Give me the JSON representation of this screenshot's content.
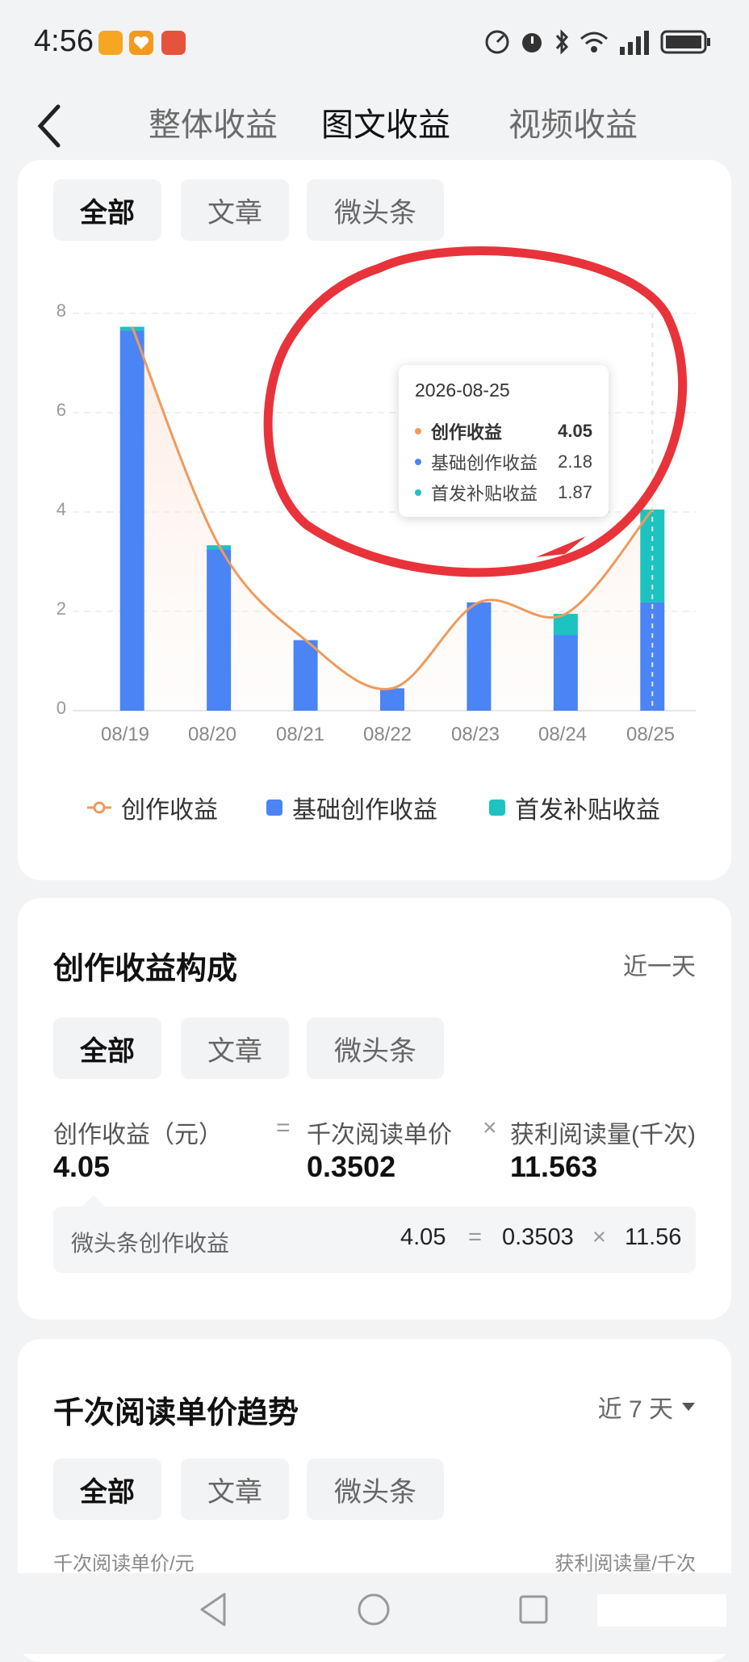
{
  "status_bar": {
    "time": "4:56"
  },
  "nav": {
    "tabs": [
      "整体收益",
      "图文收益",
      "视频收益"
    ],
    "active": 1
  },
  "chart_card": {
    "filters": [
      "全部",
      "文章",
      "微头条"
    ],
    "selected_filter": "全部",
    "y_ticks": [
      "0",
      "2",
      "4",
      "6",
      "8"
    ],
    "tooltip": {
      "date": "2026-08-25",
      "rows": [
        {
          "label": "创作收益",
          "value": "4.05",
          "color": "#ef9a5c",
          "bold": true
        },
        {
          "label": "基础创作收益",
          "value": "2.18",
          "color": "#4a84f5",
          "bold": false
        },
        {
          "label": "首发补贴收益",
          "value": "1.87",
          "color": "#1cc3c0",
          "bold": false
        }
      ]
    },
    "legend": [
      {
        "label": "创作收益",
        "color": "#ef9a5c",
        "shape": "line-dot"
      },
      {
        "label": "基础创作收益",
        "color": "#4a84f5",
        "shape": "square"
      },
      {
        "label": "首发补贴收益",
        "color": "#1cc3c0",
        "shape": "square"
      }
    ]
  },
  "chart_data": {
    "type": "bar",
    "stacked": true,
    "categories": [
      "08/19",
      "08/20",
      "08/21",
      "08/22",
      "08/23",
      "08/24",
      "08/25"
    ],
    "ylim": [
      0,
      8
    ],
    "grid": true,
    "series": [
      {
        "name": "基础创作收益",
        "type": "bar",
        "color": "#4a84f5",
        "values": [
          7.65,
          3.25,
          1.42,
          0.45,
          2.18,
          1.52,
          2.18
        ]
      },
      {
        "name": "首发补贴收益",
        "type": "bar",
        "color": "#1cc3c0",
        "values": [
          0.08,
          0.08,
          0.0,
          0.0,
          0.0,
          0.43,
          1.87
        ]
      },
      {
        "name": "创作收益",
        "type": "line",
        "smooth": true,
        "color": "#ef9a5c",
        "values": [
          7.73,
          3.33,
          1.42,
          0.45,
          2.18,
          1.95,
          4.05
        ]
      }
    ]
  },
  "composition": {
    "title": "创作收益构成",
    "period": "近一天",
    "filters": [
      "全部",
      "文章",
      "微头条"
    ],
    "selected_filter": "全部",
    "formula": {
      "income_label": "创作收益（元）",
      "income_value": "4.05",
      "eq": "=",
      "price_label": "千次阅读单价",
      "price_value": "0.3502",
      "times": "×",
      "reads_label": "获利阅读量(千次)",
      "reads_value": "11.563"
    },
    "detail": {
      "label": "微头条创作收益",
      "income": "4.05",
      "eq": "=",
      "price": "0.3503",
      "times": "×",
      "reads": "11.56"
    }
  },
  "trend": {
    "title": "千次阅读单价趋势",
    "period": "近 7 天",
    "filters": [
      "全部",
      "文章",
      "微头条"
    ],
    "selected_filter": "全部",
    "left_axis_label": "千次阅读单价/元",
    "right_axis_label": "获利阅读量/千次"
  }
}
